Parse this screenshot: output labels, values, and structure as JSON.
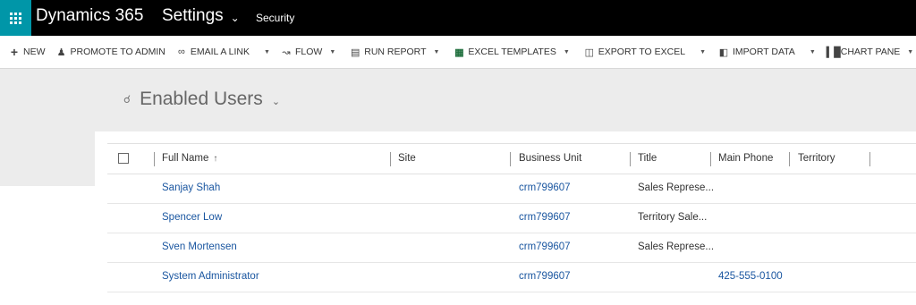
{
  "topbar": {
    "app_title": "Dynamics 365",
    "area": "Settings",
    "breadcrumb": "Security",
    "waffle_color": "#0096a8"
  },
  "commands": [
    {
      "icon": "plus-icon",
      "label": "NEW"
    },
    {
      "icon": "promote-icon",
      "label": "PROMOTE TO ADMIN"
    },
    {
      "icon": "link-icon",
      "label": "EMAIL A LINK"
    },
    {
      "icon": "flow-icon",
      "label": "FLOW"
    },
    {
      "icon": "report-icon",
      "label": "RUN REPORT"
    },
    {
      "icon": "excel-icon",
      "label": "EXCEL TEMPLATES"
    },
    {
      "icon": "export-icon",
      "label": "EXPORT TO EXCEL"
    },
    {
      "icon": "import-icon",
      "label": "IMPORT DATA"
    },
    {
      "icon": "chart-icon",
      "label": "CHART PANE"
    }
  ],
  "view": {
    "title": "Enabled Users"
  },
  "grid": {
    "columns": [
      "Full Name",
      "Site",
      "Business Unit",
      "Title",
      "Main Phone",
      "Territory"
    ],
    "rows": [
      {
        "full_name": "Sanjay Shah",
        "site": "",
        "business_unit": "crm799607",
        "title": "Sales Represe...",
        "main_phone": "",
        "territory": ""
      },
      {
        "full_name": "Spencer Low",
        "site": "",
        "business_unit": "crm799607",
        "title": "Territory Sale...",
        "main_phone": "",
        "territory": ""
      },
      {
        "full_name": "Sven Mortensen",
        "site": "",
        "business_unit": "crm799607",
        "title": "Sales Represe...",
        "main_phone": "",
        "territory": ""
      },
      {
        "full_name": "System Administrator",
        "site": "",
        "business_unit": "crm799607",
        "title": "",
        "main_phone": "425-555-0100",
        "territory": ""
      }
    ]
  }
}
